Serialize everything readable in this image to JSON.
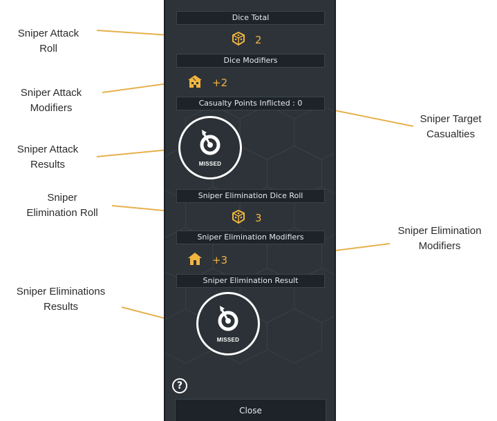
{
  "annotations": {
    "attack_roll": "Sniper Attack\nRoll",
    "attack_modifiers": "Sniper Attack\nModifiers",
    "attack_results": "Sniper Attack\nResults",
    "elimination_roll": "Sniper\nElimination Roll",
    "eliminations_results": "Sniper Eliminations\nResults",
    "target_casualties": "Sniper Target\nCasualties",
    "elimination_modifiers": "Sniper Elimination\nModifiers"
  },
  "panel": {
    "dice_total_header": "Dice Total",
    "dice_total_value": "2",
    "dice_modifiers_header": "Dice Modifiers",
    "dice_modifiers_value": "+2",
    "casualty_points": "Casualty Points Inflicted : 0",
    "attack_result_label": "MISSED",
    "elimination_roll_header": "Sniper Elimination Dice Roll",
    "elimination_roll_value": "3",
    "elimination_modifiers_header": "Sniper Elimination Modifiers",
    "elimination_modifiers_value": "+3",
    "elimination_result_header": "Sniper Elimination Result",
    "elimination_result_label": "MISSED",
    "help_label": "?",
    "close_label": "Close"
  },
  "icons": {
    "dice": "dice-icon",
    "building_damaged": "damaged-building-icon",
    "house": "house-icon",
    "target": "target-arrow-icon",
    "help": "help-icon"
  },
  "colors": {
    "accent": "#f2b441",
    "leader_line": "#e6b04a",
    "panel_bg": "#2d3338",
    "header_bg": "#1d2329"
  }
}
